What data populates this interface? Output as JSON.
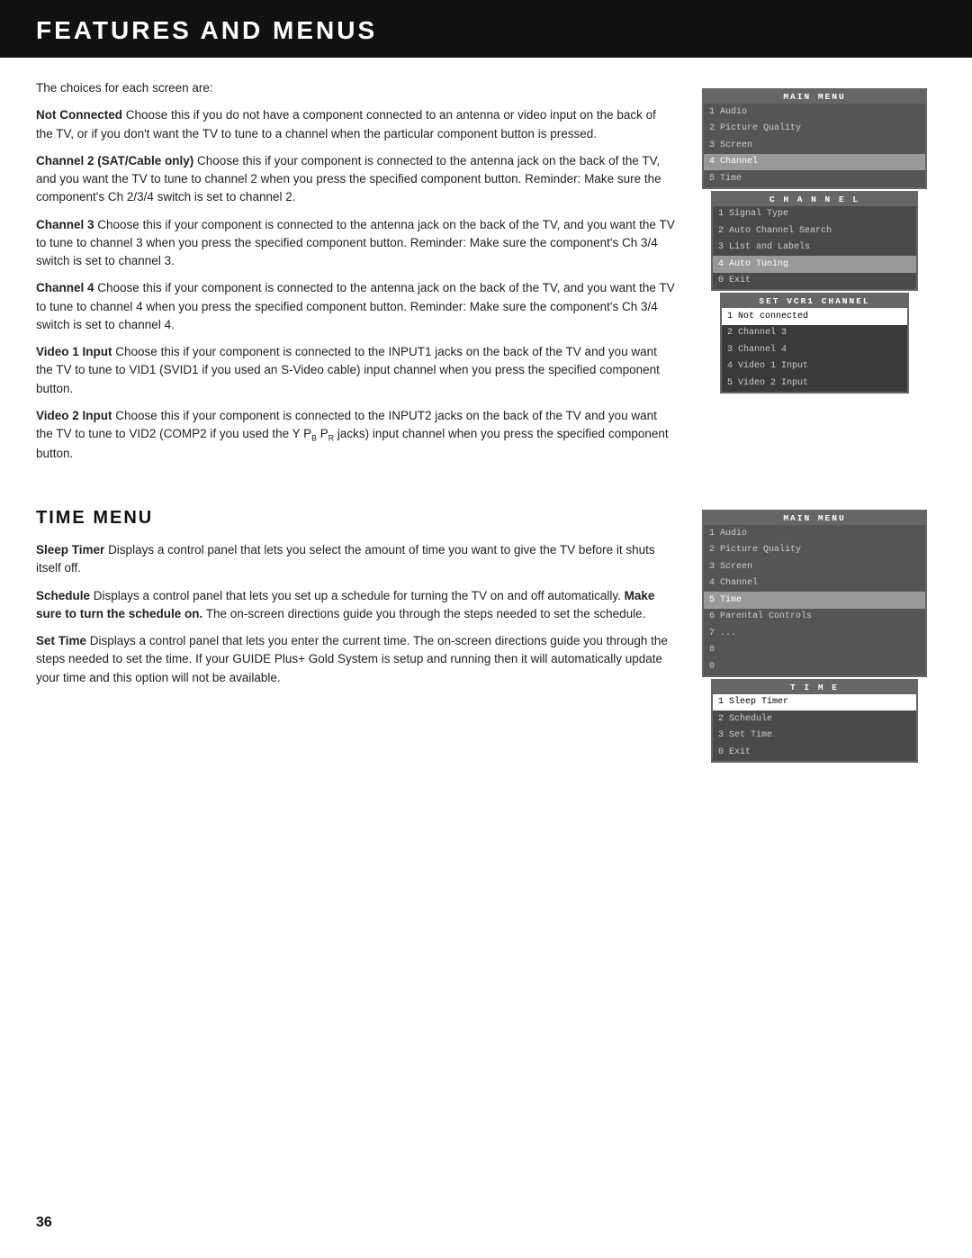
{
  "page": {
    "title": "FEATURES AND MENUS",
    "number": "36"
  },
  "section1": {
    "intro": "The choices for each screen are:",
    "paragraphs": [
      {
        "bold": "Not Connected",
        "text": "  Choose this if you do not have a component connected to an antenna or video input on the back of the TV, or if you don't want the TV to tune to a channel when the particular component button is pressed."
      },
      {
        "bold": "Channel 2 (SAT/Cable only)",
        "text": "  Choose this if your component is connected to the antenna jack on the back of the TV, and you want the TV to tune to channel 2 when you press the specified component button. Reminder: Make sure the component's Ch 2/3/4 switch is set to channel 2."
      },
      {
        "bold": "Channel 3",
        "text": "  Choose this if your component is connected to the antenna jack on the back of the TV, and you want the TV to tune to channel 3 when you press the specified component button. Reminder: Make sure the component's Ch 3/4 switch is set to channel 3."
      },
      {
        "bold": "Channel 4",
        "text": "  Choose this if your component is connected to the antenna jack on the back of the TV, and you want the TV to tune to channel 4 when you press the specified component button. Reminder: Make sure the component's Ch 3/4 switch is set to channel 4."
      },
      {
        "bold": "Video 1 Input",
        "text": "  Choose this if your component is connected to the INPUT1 jacks on the back of the TV and you want the TV to tune to VID1 (SVID1 if you used an S-Video cable) input channel when you press the specified component button."
      },
      {
        "bold": "Video 2 Input",
        "text": "  Choose this if your component is connected to the INPUT2 jacks on the back of the TV and you want the TV to tune to VID2 (COMP2 if you used the Y P"
      }
    ],
    "video2_suffix": " jacks) input channel when you press the specified component button.",
    "video2_sub1": "B",
    "video2_sub2": "R"
  },
  "menu1": {
    "title": "MAIN MENU",
    "items": [
      {
        "label": "1 Audio",
        "selected": false
      },
      {
        "label": "2 Picture Quality",
        "selected": false
      },
      {
        "label": "3 Screen",
        "selected": false
      },
      {
        "label": "4 Channel",
        "selected": true
      },
      {
        "label": "5 Time",
        "selected": false
      }
    ],
    "submenu": {
      "title": "CHANNEL",
      "items": [
        {
          "label": "1 Signal Type",
          "selected": false
        },
        {
          "label": "2 Auto Channel Search",
          "selected": false
        },
        {
          "label": "3 List and Labels",
          "selected": false
        },
        {
          "label": "4 Auto Tuning",
          "selected": true
        },
        {
          "label": "0 Exit",
          "selected": false
        }
      ],
      "submenu2": {
        "title": "SET VCR1 CHANNEL",
        "items": [
          {
            "label": "1 Not connected",
            "selected": true
          },
          {
            "label": "2 Channel 3",
            "selected": false
          },
          {
            "label": "3 Channel 4",
            "selected": false
          },
          {
            "label": "4 Video 1 Input",
            "selected": false
          },
          {
            "label": "5 Video 2 Input",
            "selected": false
          }
        ]
      }
    }
  },
  "section2": {
    "heading": "TIME MENU",
    "paragraphs": [
      {
        "bold": "Sleep Timer",
        "text": "  Displays a control panel that lets you select the amount of time you want to give the TV before it shuts itself off."
      },
      {
        "bold": "Schedule",
        "text": "  Displays a control panel that lets you set up a schedule for turning the TV on and off automatically. "
      },
      {
        "bold_inline": "Make sure to turn the schedule on.",
        "text2": " The on-screen directions guide you through the steps needed to set the schedule."
      },
      {
        "bold": "Set Time",
        "text": "  Displays a control panel that lets you enter the current time. The on-screen directions guide you through the steps needed to set the time. If your GUIDE Plus+ Gold System is setup and running then it will automatically update your time and this option will not be available."
      }
    ]
  },
  "menu2": {
    "title": "MAIN MENU",
    "items": [
      {
        "label": "1 Audio",
        "selected": false
      },
      {
        "label": "2 Picture Quality",
        "selected": false
      },
      {
        "label": "3 Screen",
        "selected": false
      },
      {
        "label": "4 Channel",
        "selected": false
      },
      {
        "label": "5 Time",
        "selected": true
      },
      {
        "label": "6 Parental Controls",
        "selected": false
      },
      {
        "label": "7 ...",
        "selected": false
      },
      {
        "label": "8",
        "selected": false
      },
      {
        "label": "0",
        "selected": false
      }
    ],
    "submenu": {
      "title": "TIME",
      "items": [
        {
          "label": "1 Sleep Timer",
          "selected": true
        },
        {
          "label": "2 Schedule",
          "selected": false
        },
        {
          "label": "3 Set Time",
          "selected": false
        },
        {
          "label": "0 Exit",
          "selected": false
        }
      ]
    }
  }
}
